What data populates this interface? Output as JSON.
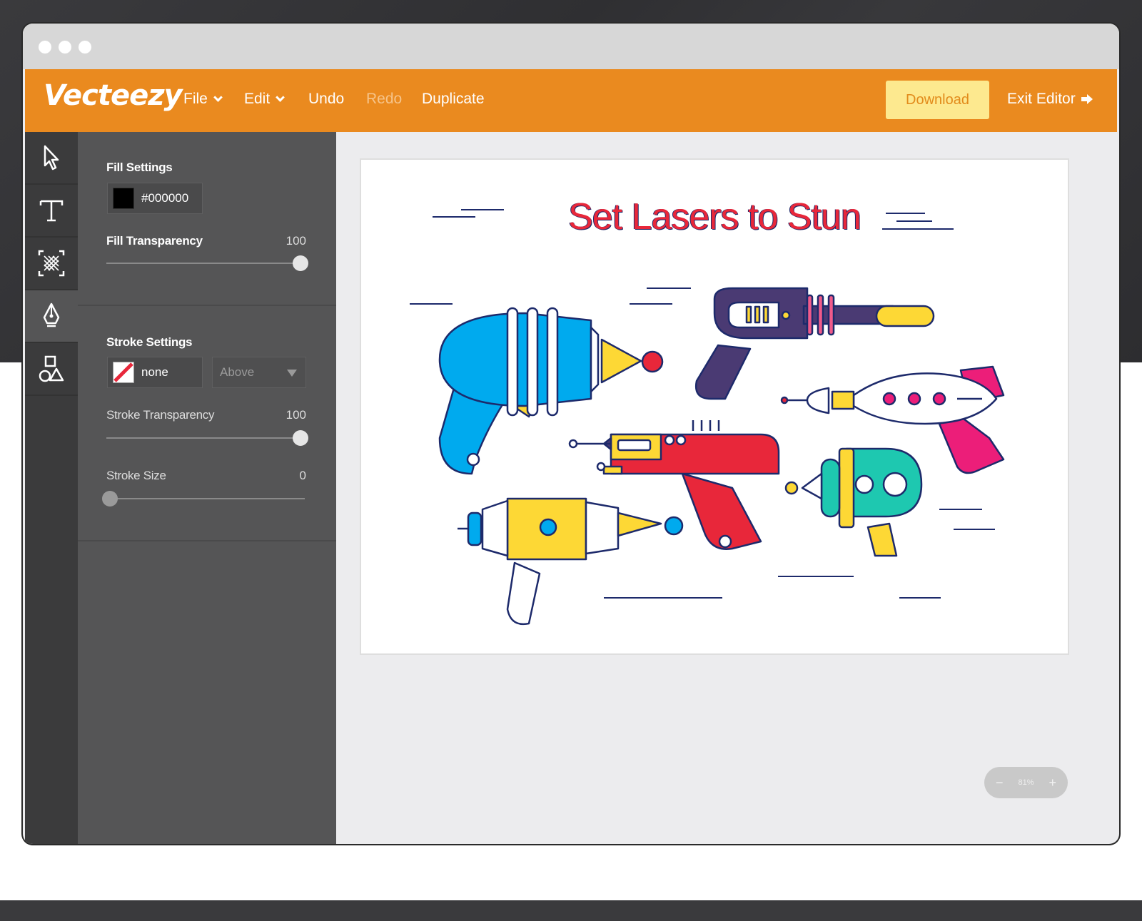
{
  "app": {
    "logo": "Vecteezy"
  },
  "menu": {
    "file": "File",
    "edit": "Edit",
    "undo": "Undo",
    "redo": "Redo",
    "duplicate": "Duplicate",
    "download": "Download",
    "exit": "Exit Editor"
  },
  "tools": [
    {
      "icon": "cursor-icon"
    },
    {
      "icon": "text-icon"
    },
    {
      "icon": "texture-icon"
    },
    {
      "icon": "pen-icon"
    },
    {
      "icon": "shapes-icon"
    }
  ],
  "fill": {
    "heading": "Fill Settings",
    "color": "#000000",
    "transparency_label": "Fill Transparency",
    "transparency_value": "100",
    "transparency_fraction": 1.0
  },
  "stroke": {
    "heading": "Stroke Settings",
    "color": "none",
    "position": "Above",
    "transparency_label": "Stroke Transparency",
    "transparency_value": "100",
    "transparency_fraction": 1.0,
    "size_label": "Stroke Size",
    "size_value": "0",
    "size_fraction": 0.0
  },
  "canvas": {
    "title": "Set Lasers to Stun"
  },
  "zoom": {
    "minus": "−",
    "value": "81%",
    "plus": "+"
  },
  "colors": {
    "toolbar": "#ea8a1f",
    "download_bg": "#fde98f",
    "panel": "#555556",
    "rail": "#3b3b3c",
    "title_red": "#e8273a",
    "outline_navy": "#1d2a6b"
  }
}
